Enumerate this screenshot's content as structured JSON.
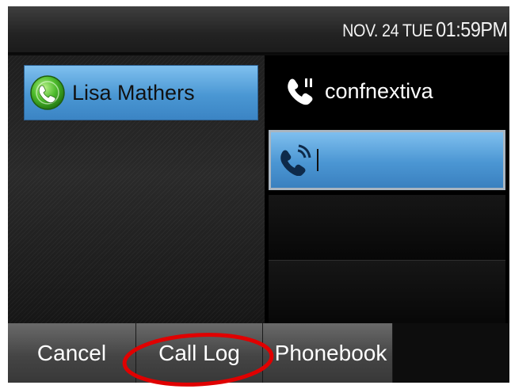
{
  "status_bar": {
    "date": "NOV. 24 TUE",
    "time": "01:59PM"
  },
  "line_key": {
    "label": "Lisa Mathers",
    "icon": "presence-phone-icon",
    "accent_color": "#4a97d3"
  },
  "account": {
    "label": "confnextiva",
    "icon": "phone-handset-icon"
  },
  "dial_entry": {
    "value": "",
    "icon": "phone-active-call-icon"
  },
  "softkeys": {
    "cancel": "Cancel",
    "call_log": "Call Log",
    "phonebook": "Phonebook"
  },
  "annotation": {
    "highlight_color": "#e00000",
    "highlight_target": "Call Log"
  }
}
